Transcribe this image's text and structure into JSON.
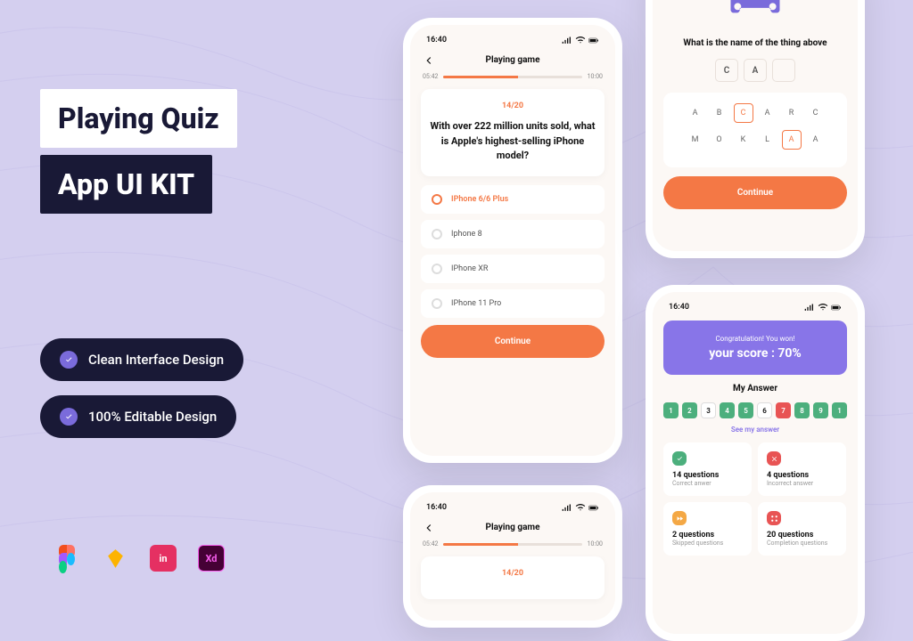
{
  "headline1": "Playing Quiz",
  "headline2": "App UI KIT",
  "feature1": "Clean Interface Design",
  "feature2": "100% Editable Design",
  "time": "16:40",
  "screen1": {
    "title": "Playing game",
    "timeStart": "05:42",
    "timeEnd": "10:00",
    "counter": "14/20",
    "question": "With over 222 million units sold, what is Apple's highest-selling iPhone model?",
    "opts": [
      "IPhone 6/6 Plus",
      "Iphone 8",
      "IPhone XR",
      "IPhone 11 Pro"
    ],
    "cta": "Continue"
  },
  "screen2": {
    "question": "What is the name of the thing above",
    "answer": [
      "C",
      "A",
      ""
    ],
    "row1": [
      "A",
      "B",
      "C",
      "A",
      "R",
      "C"
    ],
    "row2": [
      "M",
      "O",
      "K",
      "L",
      "A",
      "A"
    ],
    "cta": "Continue"
  },
  "screen3": {
    "title": "Playing game",
    "timeStart": "05:42",
    "timeEnd": "10:00",
    "counter": "14/20"
  },
  "screen4": {
    "congratsSmall": "Congratulation! You won!",
    "congratsLarge": "your score : 70%",
    "myAnswer": "My Answer",
    "nums": [
      {
        "n": "1",
        "c": "g"
      },
      {
        "n": "2",
        "c": "g"
      },
      {
        "n": "3",
        "c": "w"
      },
      {
        "n": "4",
        "c": "g"
      },
      {
        "n": "5",
        "c": "g"
      },
      {
        "n": "6",
        "c": "w"
      },
      {
        "n": "7",
        "c": "r"
      },
      {
        "n": "8",
        "c": "g"
      },
      {
        "n": "9",
        "c": "g"
      },
      {
        "n": "1",
        "c": "g"
      }
    ],
    "see": "See my answer",
    "stats": [
      {
        "n": "14 questions",
        "l": "Correct anwer",
        "c": "#4CAF7D"
      },
      {
        "n": "4 questions",
        "l": "Incorrect answer",
        "c": "#E85454"
      },
      {
        "n": "2 questions",
        "l": "Skipped questions",
        "c": "#F4A845"
      },
      {
        "n": "20 questions",
        "l": "Completion questions",
        "c": "#E85454"
      }
    ]
  }
}
